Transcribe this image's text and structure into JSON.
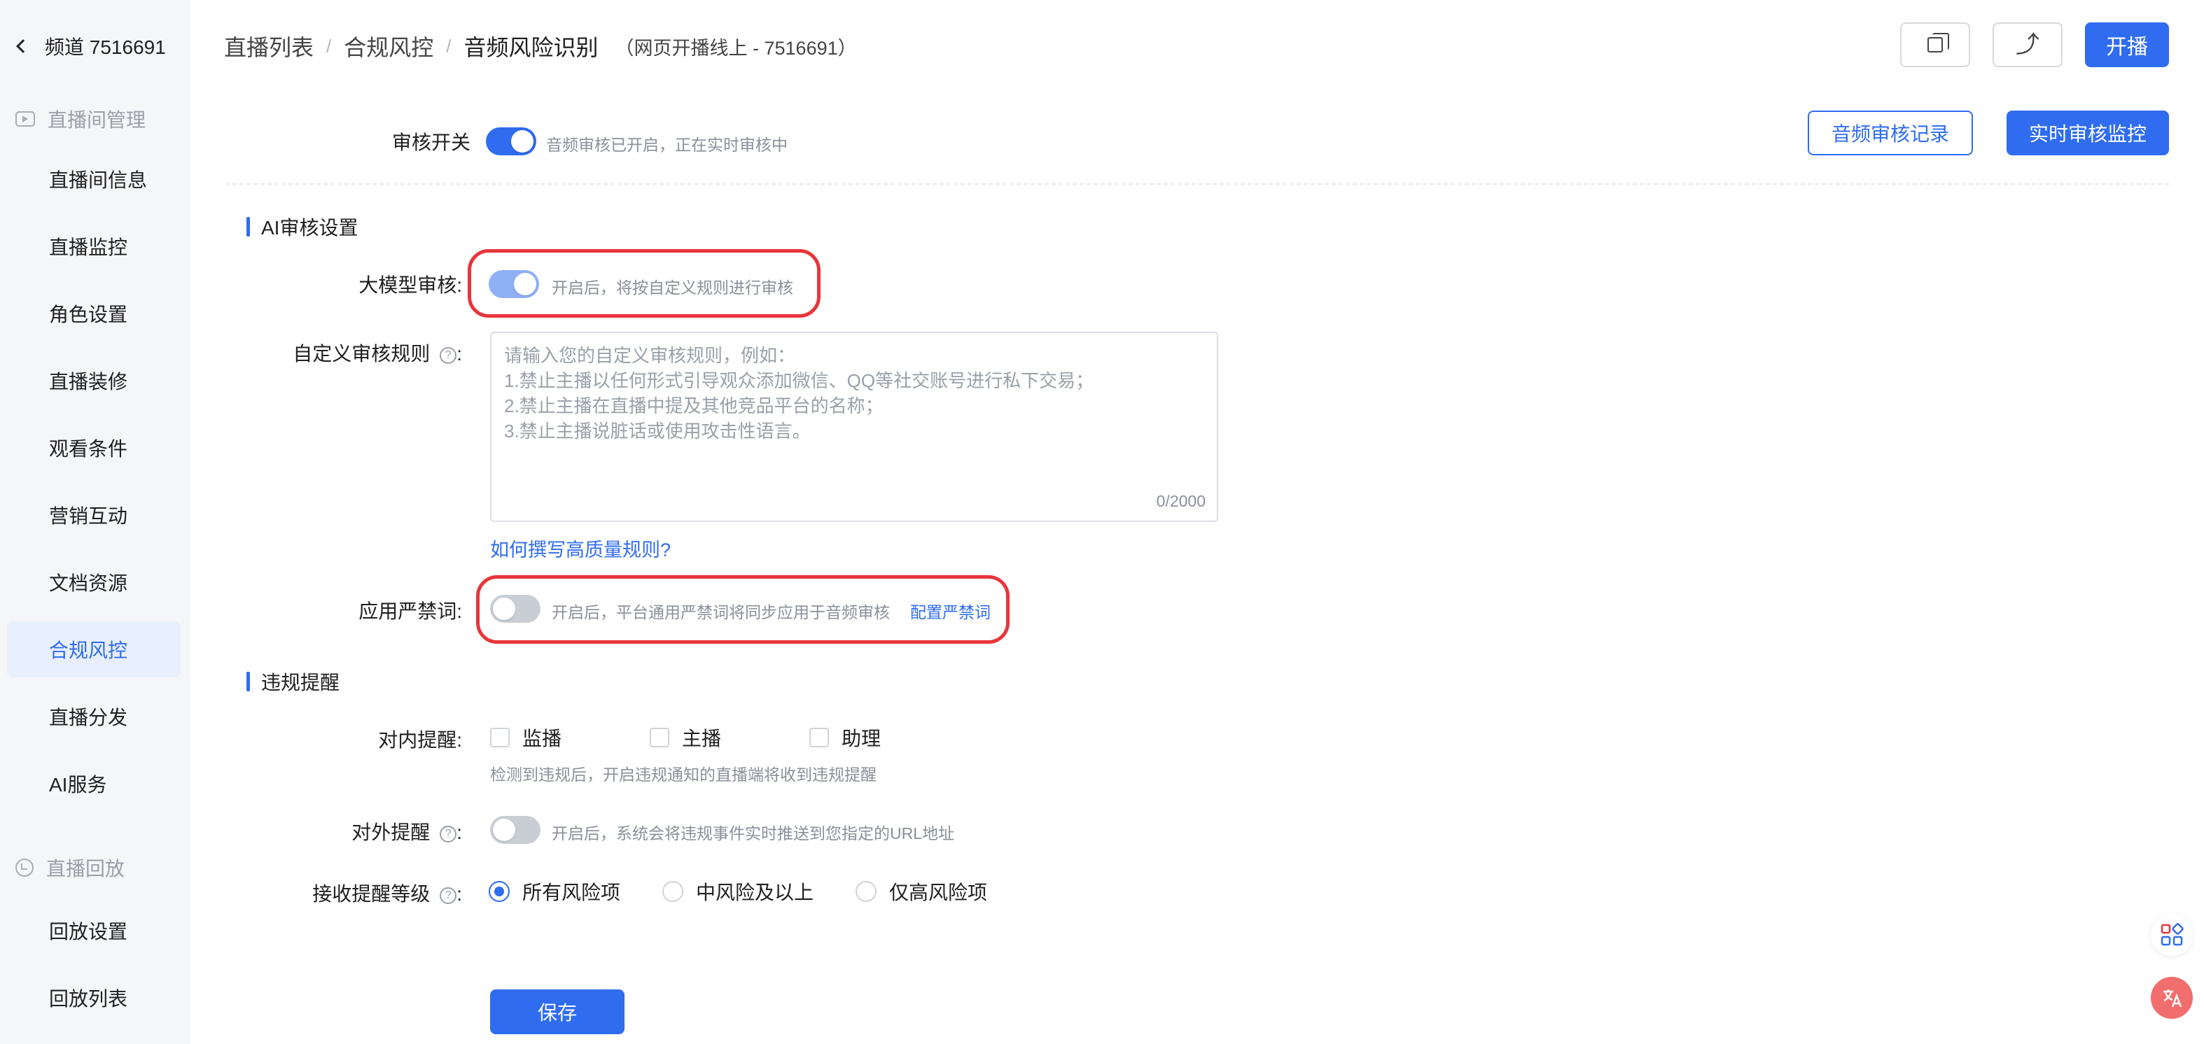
{
  "sidebar": {
    "channel_title": "频道 7516691",
    "group_live": "直播间管理",
    "items": [
      {
        "label": "直播间信息"
      },
      {
        "label": "直播监控"
      },
      {
        "label": "角色设置"
      },
      {
        "label": "直播装修"
      },
      {
        "label": "观看条件"
      },
      {
        "label": "营销互动"
      },
      {
        "label": "文档资源"
      },
      {
        "label": "合规风控",
        "active": true
      },
      {
        "label": "直播分发"
      },
      {
        "label": "AI服务"
      }
    ],
    "group_replay": "直播回放",
    "replay_items": [
      {
        "label": "回放设置"
      },
      {
        "label": "回放列表"
      }
    ]
  },
  "header": {
    "breadcrumb": [
      "直播列表",
      "合规风控",
      "音频风险识别"
    ],
    "separator": "/",
    "subtitle": "（网页开播线上 - 7516691）",
    "start_label": "开播"
  },
  "audit": {
    "switch_label": "审核开关",
    "switch_on": true,
    "switch_hint": "音频审核已开启，正在实时审核中",
    "records_btn": "音频审核记录",
    "monitor_btn": "实时审核监控"
  },
  "ai_section": {
    "title": "AI审核设置",
    "llm_label": "大模型审核:",
    "llm_on": true,
    "llm_hint": "开启后，将按自定义规则进行审核",
    "rules_label": "自定义审核规则",
    "rules_colon": ":",
    "rules_placeholder": "请输入您的自定义审核规则，例如：\n1.禁止主播以任何形式引导观众添加微信、QQ等社交账号进行私下交易；\n2.禁止主播在直播中提及其他竞品平台的名称；\n3.禁止主播说脏话或使用攻击性语言。",
    "rules_count": "0/2000",
    "rules_link": "如何撰写高质量规则?",
    "banned_label": "应用严禁词:",
    "banned_on": false,
    "banned_hint": "开启后，平台通用严禁词将同步应用于音频审核",
    "banned_link": "配置严禁词"
  },
  "violation": {
    "title": "违规提醒",
    "internal_label": "对内提醒:",
    "internal_options": [
      "监播",
      "主播",
      "助理"
    ],
    "internal_hint": "检测到违规后，开启违规通知的直播端将收到违规提醒",
    "external_label": "对外提醒",
    "external_on": false,
    "external_hint": "开启后，系统会将违规事件实时推送到您指定的URL地址",
    "level_label": "接收提醒等级",
    "levels": [
      "所有风险项",
      "中风险及以上",
      "仅高风险项"
    ],
    "level_selected": "所有风险项"
  },
  "save_label": "保存",
  "colors": {
    "accent": "#2f6cf0",
    "highlight": "#e8353b"
  },
  "icons": {
    "back": "chevron-left-icon",
    "copy": "copy-icon",
    "share": "share-icon",
    "apps": "apps-grid-icon",
    "translate": "translate-icon"
  }
}
